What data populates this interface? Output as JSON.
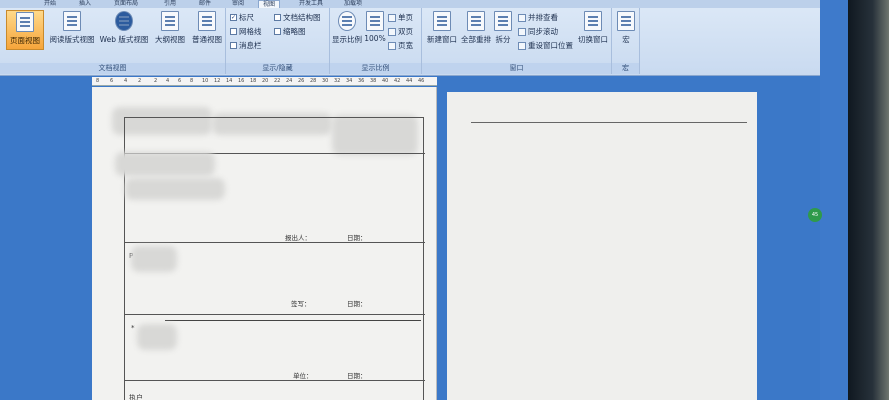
{
  "ribbon": {
    "tabs": [
      "开始",
      "插入",
      "页面布局",
      "引用",
      "邮件",
      "审阅",
      "视图",
      "开发工具",
      "加载项"
    ],
    "active_tab": "视图",
    "groups": {
      "doc_views": {
        "label": "文档视图",
        "buttons": [
          "页面视图",
          "阅读版式视图",
          "Web 版式视图",
          "大纲视图",
          "普通视图"
        ]
      },
      "show_hide": {
        "label": "显示/隐藏",
        "ruler": "标尺",
        "gridlines": "网格线",
        "message_bar": "消息栏",
        "doc_map": "文档结构图",
        "thumbnails": "缩略图"
      },
      "zoom": {
        "label": "显示比例",
        "zoom_btn": "显示比例",
        "percent": "100%",
        "one_page": "单页",
        "two_pages": "双页",
        "page_width": "页宽"
      },
      "window": {
        "label": "窗口",
        "new_window": "新建窗口",
        "arrange_all": "全部重排",
        "split": "拆分",
        "side_by_side": "并排查看",
        "sync_scroll": "同步滚动",
        "reset_pos": "重设窗口位置",
        "switch_windows": "切换窗口"
      },
      "macros": {
        "label": "宏",
        "button": "宏"
      }
    }
  },
  "ruler": {
    "ticks": [
      "8",
      "6",
      "4",
      "2",
      "2",
      "4",
      "6",
      "8",
      "10",
      "12",
      "14",
      "16",
      "18",
      "20",
      "22",
      "24",
      "26",
      "28",
      "30",
      "32",
      "34",
      "36",
      "38",
      "40",
      "42",
      "44",
      "46"
    ]
  },
  "document": {
    "sig_1_label": "报出人：",
    "date_1": "日期：",
    "sig_2_label": "签写：",
    "date_2": "日期：",
    "sig_3_label": "单位：",
    "date_3": "日期：",
    "bullet_1": "P",
    "bullet_2": "*",
    "bullet_3": "执户"
  },
  "floating": {
    "badge": "45"
  }
}
